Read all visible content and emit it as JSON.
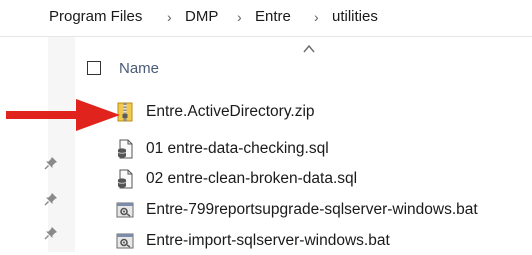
{
  "breadcrumb": {
    "items": [
      "Program Files",
      "DMP",
      "Entre",
      "utilities"
    ],
    "separator": "›"
  },
  "header": {
    "name_label": "Name"
  },
  "files": [
    {
      "name": "Entre.ActiveDirectory.zip",
      "icon": "zip-folder-icon"
    },
    {
      "name": "01 entre-data-checking.sql",
      "icon": "sql-file-icon"
    },
    {
      "name": "02 entre-clean-broken-data.sql",
      "icon": "sql-file-icon"
    },
    {
      "name": "Entre-799reportsupgrade-sqlserver-windows.bat",
      "icon": "bat-file-icon"
    },
    {
      "name": "Entre-import-sqlserver-windows.bat",
      "icon": "bat-file-icon"
    }
  ],
  "colors": {
    "annotation_arrow": "#e0231c",
    "header_text": "#4a5b78"
  }
}
